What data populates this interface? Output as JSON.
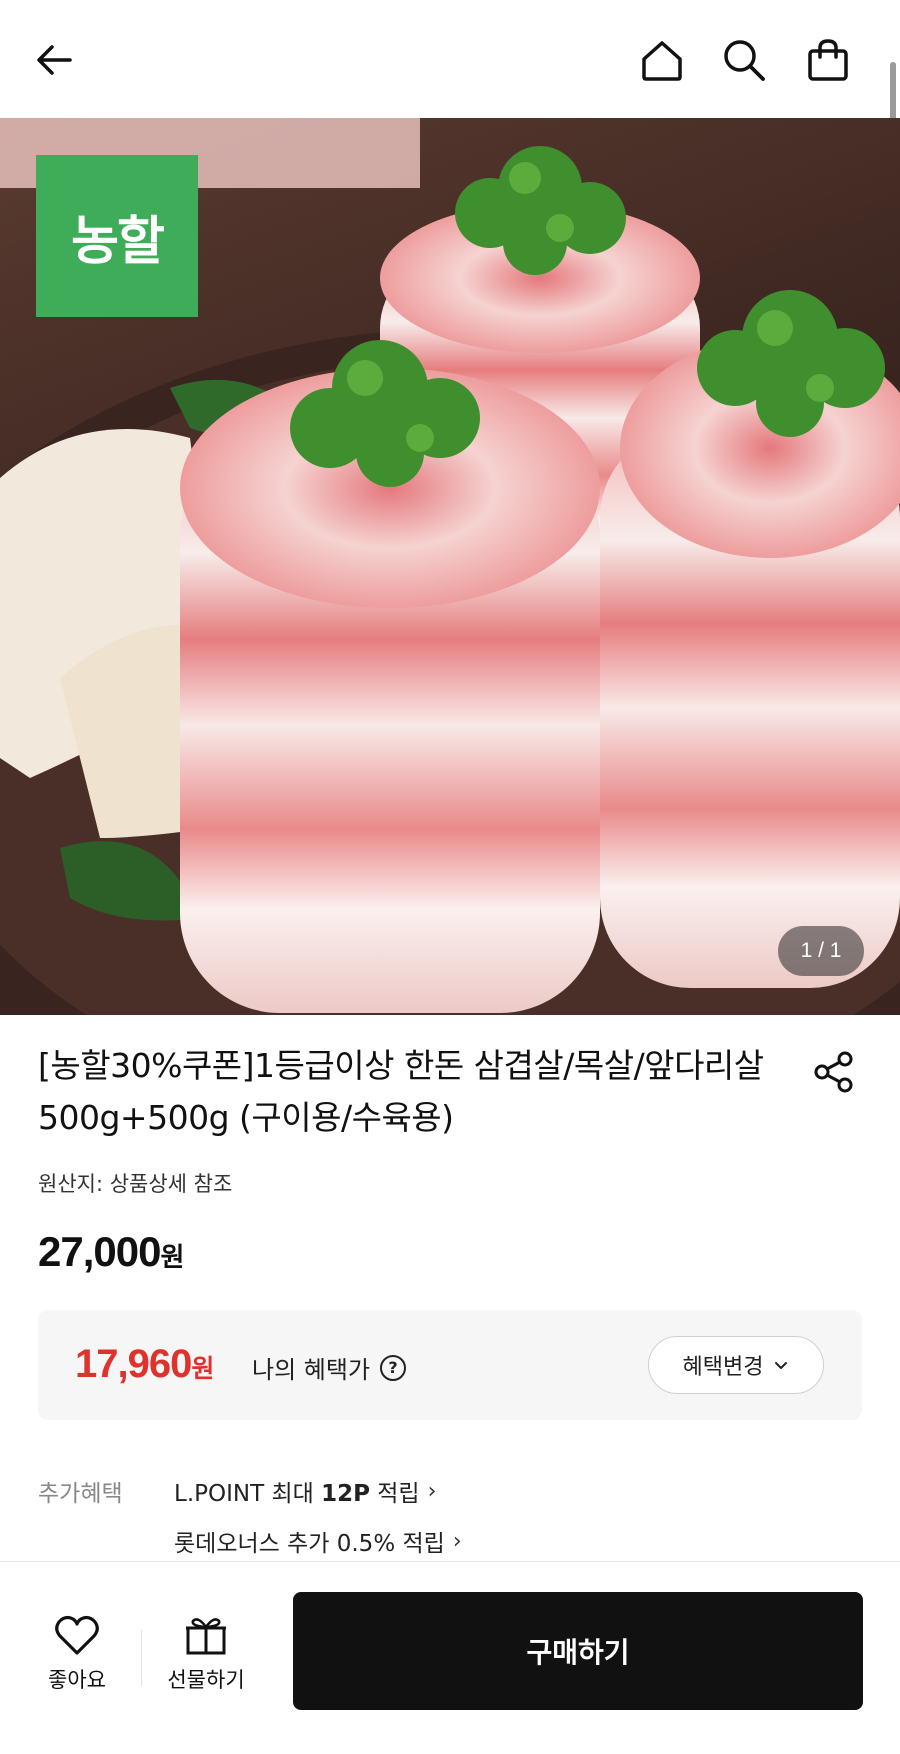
{
  "header": {
    "back_icon": "arrow-left-icon",
    "home_icon": "home-icon",
    "search_icon": "search-icon",
    "cart_icon": "shopping-bag-icon"
  },
  "hero": {
    "brand_logo_text": "농할",
    "image_counter": "1 / 1"
  },
  "product": {
    "title": "[농할30%쿠폰]1등급이상 한돈 삼겹살/목살/앞다리살 500g+500g (구이용/수육용)",
    "share_icon": "share-icon",
    "origin": "원산지: 상품상세 참조",
    "price_value": "27,000",
    "price_unit": "원"
  },
  "benefit": {
    "price_value": "17,960",
    "price_unit": "원",
    "label": "나의 혜택가",
    "help_symbol": "?",
    "change_button": "혜택변경",
    "price_color": "#e0322d"
  },
  "extra_benefits": {
    "label": "추가혜택",
    "items": [
      {
        "prefix": "L.POINT 최대 ",
        "bold": "12P",
        "suffix": " 적립"
      },
      {
        "prefix": "롯데오너스 추가 0.5% 적립",
        "bold": "",
        "suffix": ""
      }
    ]
  },
  "bottom_bar": {
    "like_label": "좋아요",
    "gift_label": "선물하기",
    "buy_label": "구매하기"
  }
}
